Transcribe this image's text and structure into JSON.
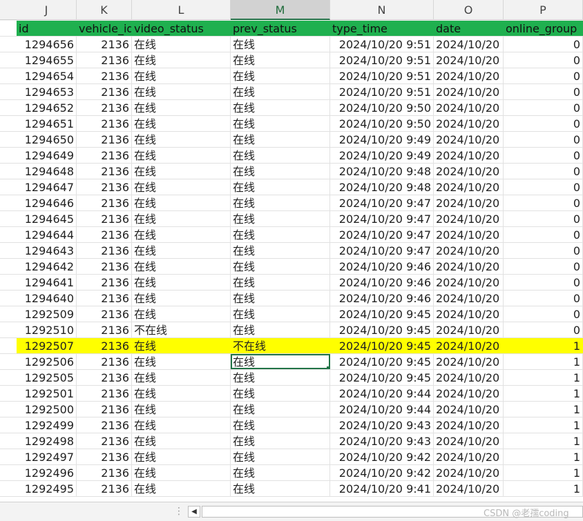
{
  "columns": [
    "J",
    "K",
    "L",
    "M",
    "N",
    "O",
    "P"
  ],
  "selected_column": "M",
  "header": [
    "id",
    "vehicle_id",
    "video_status",
    "prev_status",
    "type_time",
    "date",
    "online_group"
  ],
  "rows": [
    [
      "1294656",
      "2136",
      "在线",
      "在线",
      "2024/10/20 9:51",
      "2024/10/20",
      "0"
    ],
    [
      "1294655",
      "2136",
      "在线",
      "在线",
      "2024/10/20 9:51",
      "2024/10/20",
      "0"
    ],
    [
      "1294654",
      "2136",
      "在线",
      "在线",
      "2024/10/20 9:51",
      "2024/10/20",
      "0"
    ],
    [
      "1294653",
      "2136",
      "在线",
      "在线",
      "2024/10/20 9:51",
      "2024/10/20",
      "0"
    ],
    [
      "1294652",
      "2136",
      "在线",
      "在线",
      "2024/10/20 9:50",
      "2024/10/20",
      "0"
    ],
    [
      "1294651",
      "2136",
      "在线",
      "在线",
      "2024/10/20 9:50",
      "2024/10/20",
      "0"
    ],
    [
      "1294650",
      "2136",
      "在线",
      "在线",
      "2024/10/20 9:49",
      "2024/10/20",
      "0"
    ],
    [
      "1294649",
      "2136",
      "在线",
      "在线",
      "2024/10/20 9:49",
      "2024/10/20",
      "0"
    ],
    [
      "1294648",
      "2136",
      "在线",
      "在线",
      "2024/10/20 9:48",
      "2024/10/20",
      "0"
    ],
    [
      "1294647",
      "2136",
      "在线",
      "在线",
      "2024/10/20 9:48",
      "2024/10/20",
      "0"
    ],
    [
      "1294646",
      "2136",
      "在线",
      "在线",
      "2024/10/20 9:47",
      "2024/10/20",
      "0"
    ],
    [
      "1294645",
      "2136",
      "在线",
      "在线",
      "2024/10/20 9:47",
      "2024/10/20",
      "0"
    ],
    [
      "1294644",
      "2136",
      "在线",
      "在线",
      "2024/10/20 9:47",
      "2024/10/20",
      "0"
    ],
    [
      "1294643",
      "2136",
      "在线",
      "在线",
      "2024/10/20 9:47",
      "2024/10/20",
      "0"
    ],
    [
      "1294642",
      "2136",
      "在线",
      "在线",
      "2024/10/20 9:46",
      "2024/10/20",
      "0"
    ],
    [
      "1294641",
      "2136",
      "在线",
      "在线",
      "2024/10/20 9:46",
      "2024/10/20",
      "0"
    ],
    [
      "1294640",
      "2136",
      "在线",
      "在线",
      "2024/10/20 9:46",
      "2024/10/20",
      "0"
    ],
    [
      "1292509",
      "2136",
      "在线",
      "在线",
      "2024/10/20 9:45",
      "2024/10/20",
      "0"
    ],
    [
      "1292510",
      "2136",
      "不在线",
      "在线",
      "2024/10/20 9:45",
      "2024/10/20",
      "0"
    ],
    [
      "1292507",
      "2136",
      "在线",
      "不在线",
      "2024/10/20 9:45",
      "2024/10/20",
      "1"
    ],
    [
      "1292506",
      "2136",
      "在线",
      "在线",
      "2024/10/20 9:45",
      "2024/10/20",
      "1"
    ],
    [
      "1292505",
      "2136",
      "在线",
      "在线",
      "2024/10/20 9:45",
      "2024/10/20",
      "1"
    ],
    [
      "1292501",
      "2136",
      "在线",
      "在线",
      "2024/10/20 9:44",
      "2024/10/20",
      "1"
    ],
    [
      "1292500",
      "2136",
      "在线",
      "在线",
      "2024/10/20 9:44",
      "2024/10/20",
      "1"
    ],
    [
      "1292499",
      "2136",
      "在线",
      "在线",
      "2024/10/20 9:43",
      "2024/10/20",
      "1"
    ],
    [
      "1292498",
      "2136",
      "在线",
      "在线",
      "2024/10/20 9:43",
      "2024/10/20",
      "1"
    ],
    [
      "1292497",
      "2136",
      "在线",
      "在线",
      "2024/10/20 9:42",
      "2024/10/20",
      "1"
    ],
    [
      "1292496",
      "2136",
      "在线",
      "在线",
      "2024/10/20 9:42",
      "2024/10/20",
      "1"
    ],
    [
      "1292495",
      "2136",
      "在线",
      "在线",
      "2024/10/20 9:41",
      "2024/10/20",
      "1"
    ]
  ],
  "highlighted_row_id": "1292507",
  "active_cell": {
    "row_id": "1292506",
    "column": "M"
  },
  "highlight_color": "#ffff00",
  "header_color": "#1fb04f",
  "watermark": "CSDN @老孺coding",
  "icons": {
    "scroll_left": "triangle-left-icon",
    "sheet_dots": "vertical-dots-icon"
  }
}
